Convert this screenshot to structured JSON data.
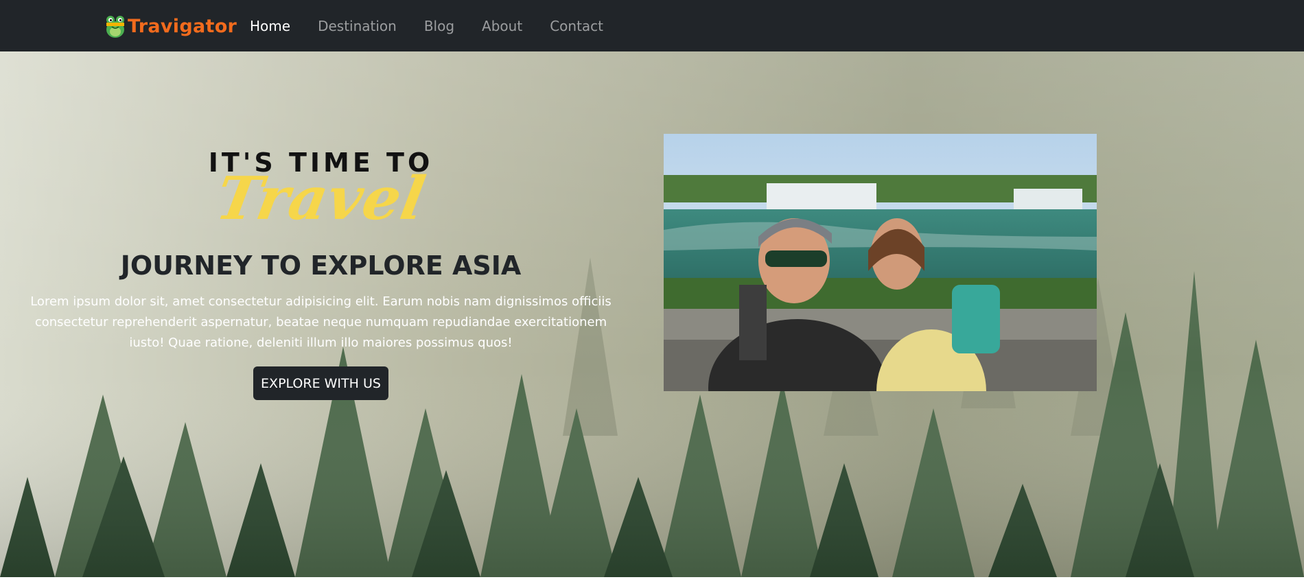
{
  "brand": {
    "name": "Travigator",
    "color": "#f26b1d"
  },
  "nav": {
    "items": [
      {
        "label": "Home",
        "active": true
      },
      {
        "label": "Destination",
        "active": false
      },
      {
        "label": "Blog",
        "active": false
      },
      {
        "label": "About",
        "active": false
      },
      {
        "label": "Contact",
        "active": false
      }
    ]
  },
  "hero": {
    "tagline_top": "IT'S TIME TO",
    "tagline_script": "Travel",
    "title": "JOURNEY TO EXPLORE ASIA",
    "description": "Lorem ipsum dolor sit, amet consectetur adipisicing elit. Earum nobis nam dignissimos officiis consectetur reprehenderit aspernatur, beatae neque numquam repudiandae exercitationem iusto! Quae ratione, deleniti illum illo maiores possimus quos!",
    "cta_label": "EXPLORE WITH US",
    "photo_alt": "couple-selfie-at-waterfall"
  },
  "colors": {
    "navbar": "#212529",
    "script_yellow": "#f6d64a",
    "button": "#212529"
  }
}
